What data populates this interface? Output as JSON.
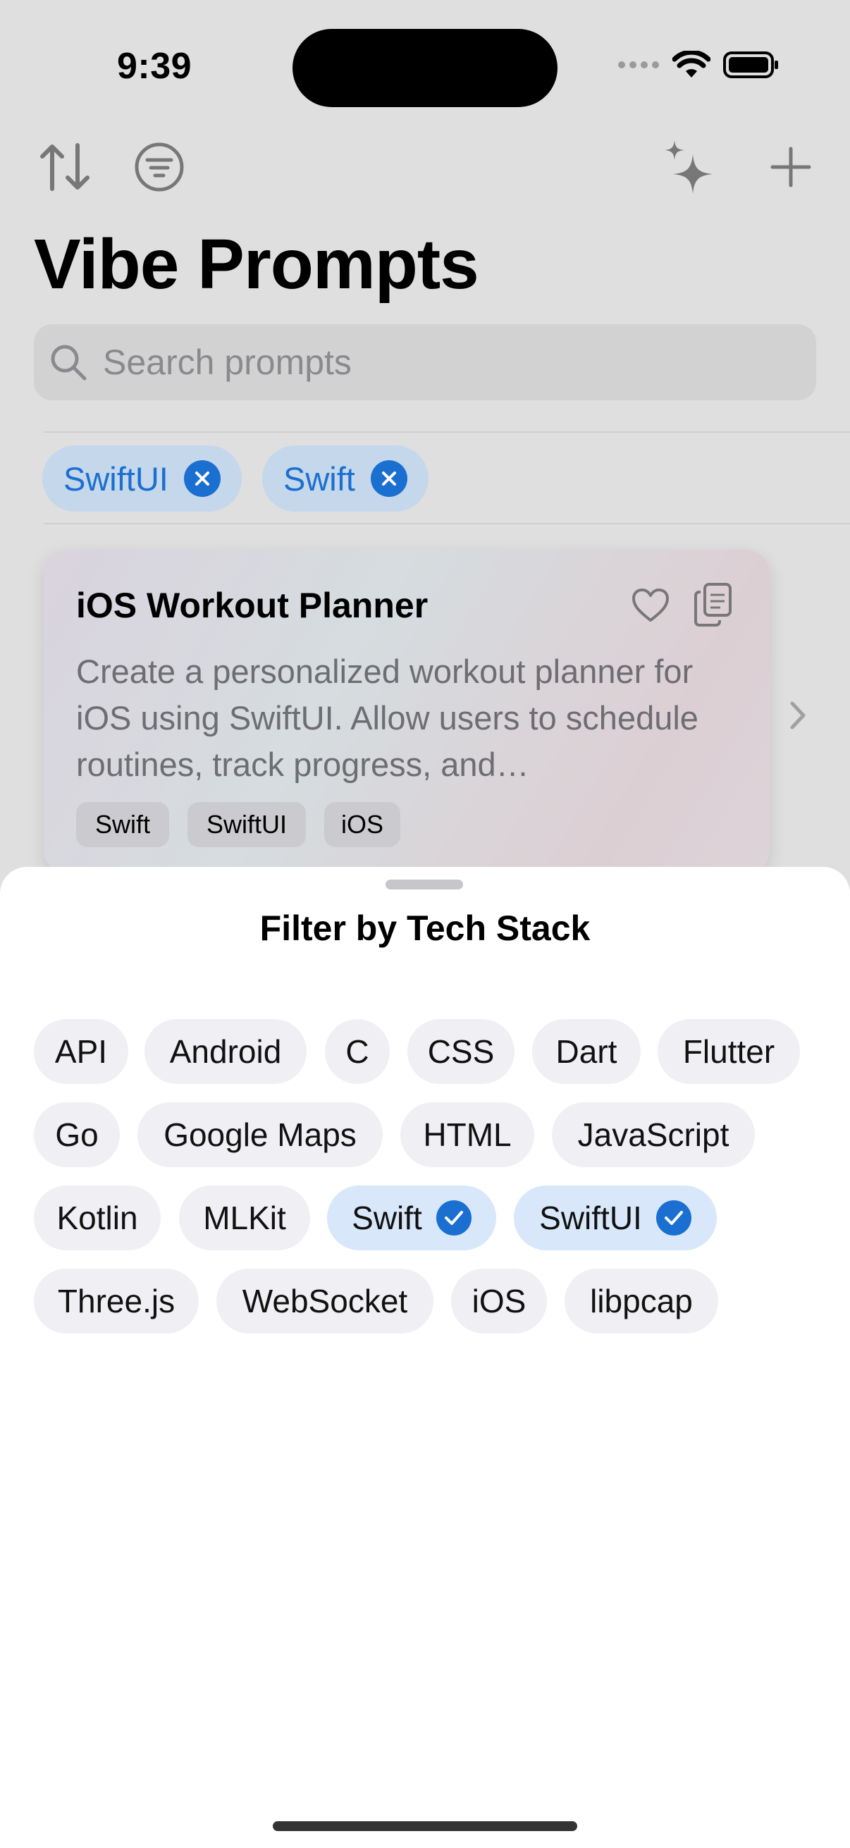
{
  "status": {
    "time": "9:39"
  },
  "toolbar": {
    "icons": [
      "sort-icon",
      "filter-icon",
      "sparkles-icon",
      "plus-icon"
    ]
  },
  "app": {
    "title": "Vibe Prompts"
  },
  "search": {
    "placeholder": "Search prompts"
  },
  "active_filters": [
    "SwiftUI",
    "Swift"
  ],
  "card": {
    "title": "iOS Workout Planner",
    "description": "Create a personalized workout planner for iOS using SwiftUI. Allow users to schedule routines, track progress, and…",
    "tags": [
      "Swift",
      "SwiftUI",
      "iOS"
    ]
  },
  "sheet": {
    "title": "Filter by Tech Stack",
    "chips": [
      {
        "label": "API",
        "selected": false
      },
      {
        "label": "Android",
        "selected": false
      },
      {
        "label": "C",
        "selected": false
      },
      {
        "label": "CSS",
        "selected": false
      },
      {
        "label": "Dart",
        "selected": false
      },
      {
        "label": "Flutter",
        "selected": false
      },
      {
        "label": "Go",
        "selected": false
      },
      {
        "label": "Google Maps",
        "selected": false
      },
      {
        "label": "HTML",
        "selected": false
      },
      {
        "label": "JavaScript",
        "selected": false
      },
      {
        "label": "Kotlin",
        "selected": false
      },
      {
        "label": "MLKit",
        "selected": false
      },
      {
        "label": "Swift",
        "selected": true
      },
      {
        "label": "SwiftUI",
        "selected": true
      },
      {
        "label": "Three.js",
        "selected": false
      },
      {
        "label": "WebSocket",
        "selected": false
      },
      {
        "label": "iOS",
        "selected": false
      },
      {
        "label": "libpcap",
        "selected": false
      }
    ]
  },
  "colors": {
    "accent": "#1a6fd0",
    "chip_bg": "#f0f0f4",
    "chip_selected_bg": "#d8e8fa"
  }
}
